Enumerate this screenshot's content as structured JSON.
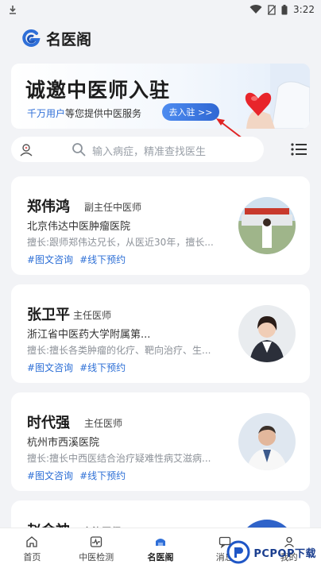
{
  "status_bar": {
    "time": "3:22",
    "icons": [
      "download-icon",
      "wifi-icon",
      "no-sim-icon",
      "battery-icon"
    ]
  },
  "header": {
    "title": "名医阁",
    "logo": "g-logo-icon"
  },
  "banner": {
    "title": "诚邀中医师入驻",
    "subtitle_highlight": "千万用户",
    "subtitle_rest": "等您提供中医服务",
    "button_label": "去入驻 >>"
  },
  "search": {
    "placeholder": "输入病症，精准查找医生",
    "left_icon": "doctor-avatar-icon",
    "right_icon": "list-icon"
  },
  "doctors": [
    {
      "name": "郑伟鸿",
      "title": "副主任中医师",
      "hospital": "北京伟达中医肿瘤医院",
      "skill": "擅长:跟师郑伟达兄长，从医近30年，擅长...",
      "tags": [
        "#图文咨询",
        "#线下预约"
      ]
    },
    {
      "name": "张卫平",
      "title": "主任医师",
      "hospital": "浙江省中医药大学附属第...",
      "skill": "擅长:擅长各类肿瘤的化疗、靶向治疗、生...",
      "tags": [
        "#图文咨询",
        "#线下预约"
      ]
    },
    {
      "name": "时代强",
      "title": "主任医师",
      "hospital": "杭州市西溪医院",
      "skill": "擅长:擅长中西医结合治疗疑难性病艾滋病...",
      "tags": [
        "#图文咨询",
        "#线下预约"
      ]
    }
  ],
  "partial_doctor": {
    "name": "赵金神",
    "title": "主治医师"
  },
  "tab_bar": {
    "tabs": [
      {
        "label": "首页",
        "icon": "home-icon"
      },
      {
        "label": "中医检测",
        "icon": "pulse-icon"
      },
      {
        "label": "名医阁",
        "icon": "doctor-hat-icon"
      },
      {
        "label": "消息",
        "icon": "message-icon"
      },
      {
        "label": "我的",
        "icon": "user-icon"
      }
    ],
    "active": "名医阁"
  },
  "watermark": {
    "text": "PCPOP下载"
  },
  "colors": {
    "accent": "#2f6fd8",
    "background": "#f2f3f6",
    "card": "#ffffff"
  }
}
